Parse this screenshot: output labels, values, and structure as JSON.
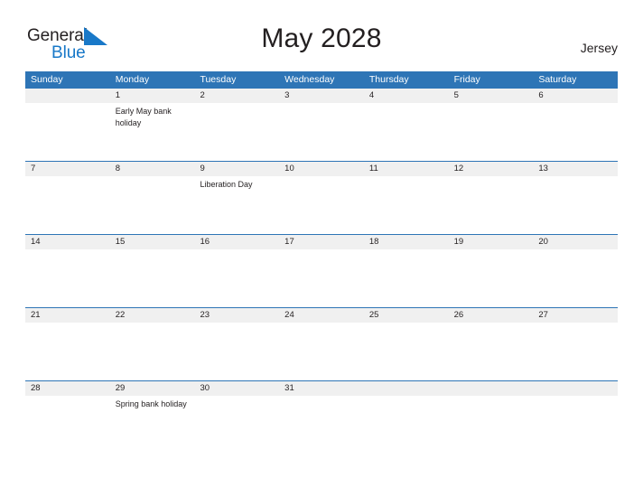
{
  "branding": {
    "name_part1": "General",
    "name_part2": "Blue",
    "flag_icon": "flag-triangle-icon",
    "brand_blue": "#1878c8"
  },
  "header": {
    "title": "May 2028",
    "region": "Jersey"
  },
  "theme": {
    "header_blue": "#2e75b6",
    "date_band_gray": "#f0f0f0",
    "text_dark": "#231f20",
    "background": "#ffffff"
  },
  "calendar": {
    "weekdays": [
      "Sunday",
      "Monday",
      "Tuesday",
      "Wednesday",
      "Thursday",
      "Friday",
      "Saturday"
    ],
    "weeks": [
      {
        "days": [
          {
            "date": "",
            "event": ""
          },
          {
            "date": "1",
            "event": "Early May bank holiday"
          },
          {
            "date": "2",
            "event": ""
          },
          {
            "date": "3",
            "event": ""
          },
          {
            "date": "4",
            "event": ""
          },
          {
            "date": "5",
            "event": ""
          },
          {
            "date": "6",
            "event": ""
          }
        ]
      },
      {
        "days": [
          {
            "date": "7",
            "event": ""
          },
          {
            "date": "8",
            "event": ""
          },
          {
            "date": "9",
            "event": "Liberation Day"
          },
          {
            "date": "10",
            "event": ""
          },
          {
            "date": "11",
            "event": ""
          },
          {
            "date": "12",
            "event": ""
          },
          {
            "date": "13",
            "event": ""
          }
        ]
      },
      {
        "days": [
          {
            "date": "14",
            "event": ""
          },
          {
            "date": "15",
            "event": ""
          },
          {
            "date": "16",
            "event": ""
          },
          {
            "date": "17",
            "event": ""
          },
          {
            "date": "18",
            "event": ""
          },
          {
            "date": "19",
            "event": ""
          },
          {
            "date": "20",
            "event": ""
          }
        ]
      },
      {
        "days": [
          {
            "date": "21",
            "event": ""
          },
          {
            "date": "22",
            "event": ""
          },
          {
            "date": "23",
            "event": ""
          },
          {
            "date": "24",
            "event": ""
          },
          {
            "date": "25",
            "event": ""
          },
          {
            "date": "26",
            "event": ""
          },
          {
            "date": "27",
            "event": ""
          }
        ]
      },
      {
        "days": [
          {
            "date": "28",
            "event": ""
          },
          {
            "date": "29",
            "event": "Spring bank holiday"
          },
          {
            "date": "30",
            "event": ""
          },
          {
            "date": "31",
            "event": ""
          },
          {
            "date": "",
            "event": ""
          },
          {
            "date": "",
            "event": ""
          },
          {
            "date": "",
            "event": ""
          }
        ]
      }
    ]
  }
}
